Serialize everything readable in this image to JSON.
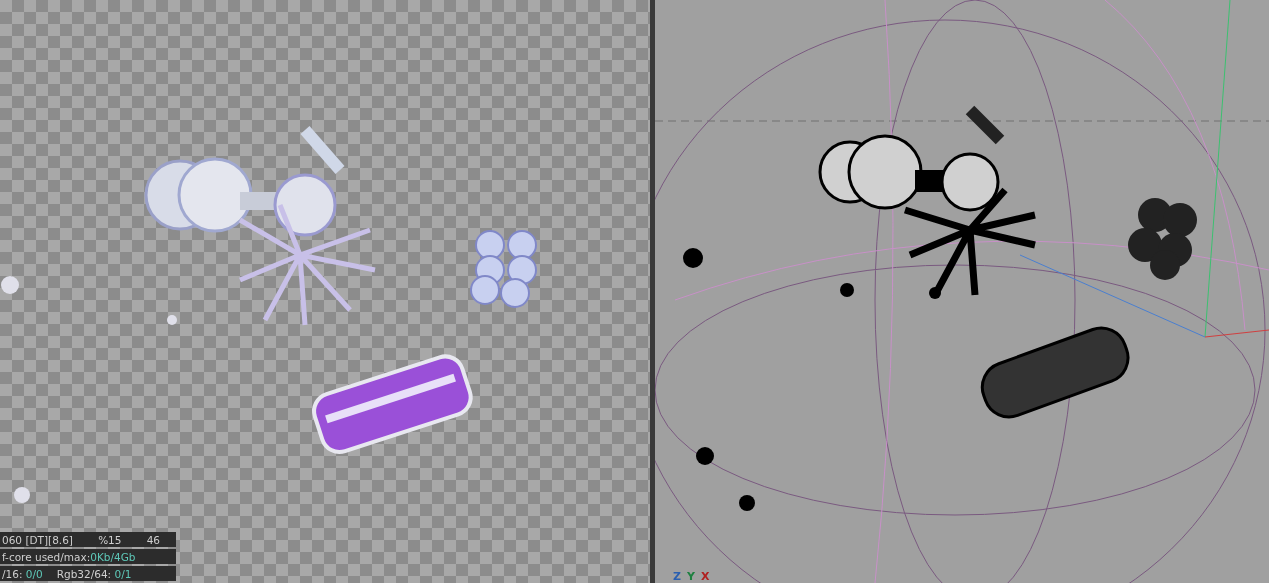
{
  "render_view": {
    "stats": [
      {
        "cells": [
          {
            "text": "060 [DT][8.6]"
          },
          {
            "text": "%15"
          },
          {
            "text": "46"
          }
        ]
      },
      {
        "cells": [
          {
            "text": "f-core used/max:",
            "value": "0Kb/4Gb"
          }
        ]
      },
      {
        "cells": [
          {
            "text": "/16: ",
            "value": "0/0"
          },
          {
            "text": "Rgb32/64: ",
            "value": "0/1"
          }
        ]
      }
    ]
  },
  "viewport": {
    "axis_labels": [
      {
        "text": "Z",
        "color": "#2a5fb0"
      },
      {
        "text": "Y",
        "color": "#1e8040"
      },
      {
        "text": "X",
        "color": "#b02020"
      }
    ]
  }
}
